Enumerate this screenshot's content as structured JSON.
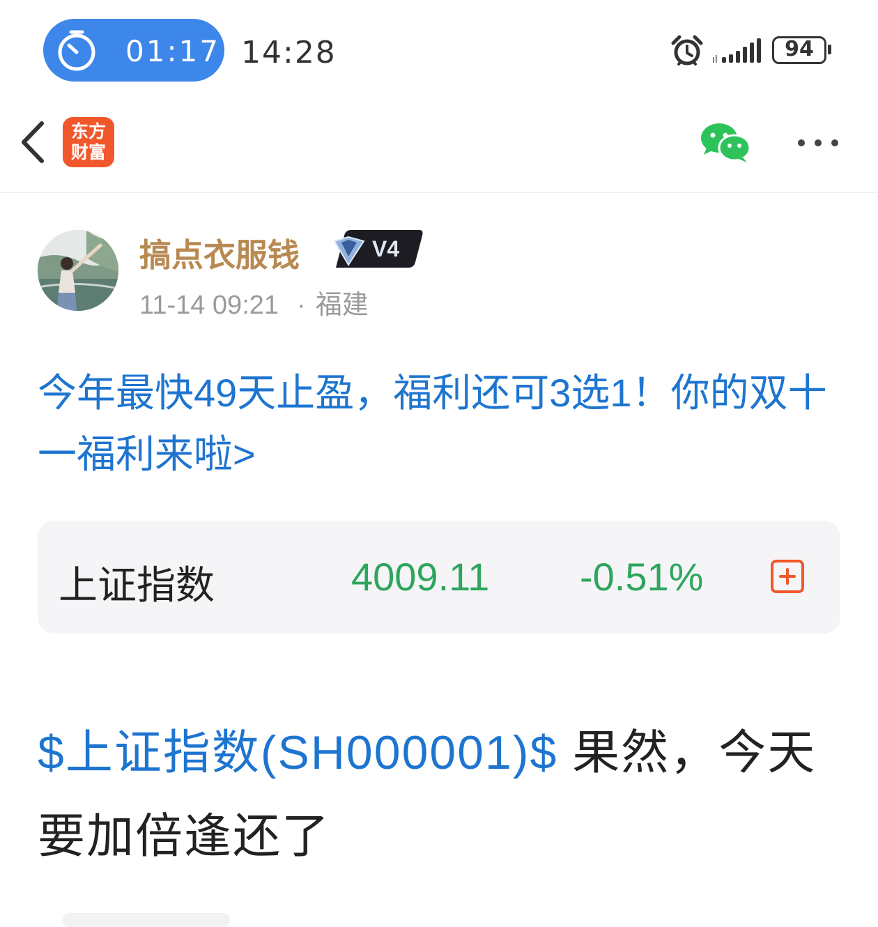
{
  "status_bar": {
    "timer": "01:17",
    "time": "14:28",
    "battery": "94",
    "icons": [
      "stopwatch-icon",
      "alarm-icon",
      "signal-icon",
      "battery-icon"
    ]
  },
  "header": {
    "logo_line1": "东方",
    "logo_line2": "财富",
    "icons": [
      "back-icon",
      "wechat-icon",
      "more-icon"
    ],
    "colors": {
      "brand": "#f2572b",
      "wechat": "#2ec35a"
    }
  },
  "author": {
    "name": "搞点衣服钱",
    "vip_level": "V4",
    "date": "11-14 09:21",
    "dot": "·",
    "location": "福建"
  },
  "promo": {
    "text": "今年最快49天止盈，福利还可3选1！你的双十一福利来啦>"
  },
  "stock_card": {
    "name": "上证指数",
    "price": "4009.11",
    "change": "-0.51%",
    "colors": {
      "down": "#2ea55c"
    }
  },
  "post": {
    "tag": "$上证指数(SH000001)$",
    "text": " 果然，今天要加倍逢还了"
  },
  "colors": {
    "link": "#1e75d0",
    "author_name": "#b88a52",
    "timer_pill": "#3d86ea"
  }
}
